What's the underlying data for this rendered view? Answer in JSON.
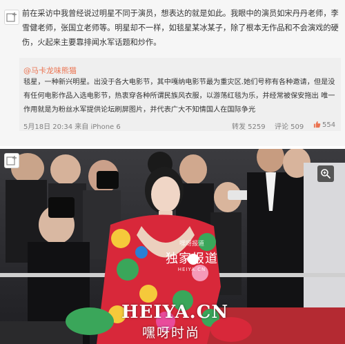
{
  "post": {
    "text": "前在采访中我曾经说过明星不同于演员，想表达的就是如此。我眼中的演员如宋丹丹老师，李雪健老师，张国立老师等。明星却不一样，如毯星某冰某子，除了根本无作品和不会演戏的硬伤，火起来主要靠排闻水军话题和炒作。",
    "quote": {
      "author": "@马卡龙味熊猫",
      "text": "毯星，一种新兴明星。出没于各大电影节，其中嘎纳电影节最为重灾区.她们号称有各种邀请，但是没有任何电影作品入选电影节，热衷穿各种所谓民族风衣服，以游荡红毯为乐，并经常被保安拖出 唯一作用就是为粉丝水军提供论坛刷屏图片，并代表广大不知情国人在国际争光"
    },
    "meta": {
      "time": "5月18日 20:34 来自 iPhone 6",
      "repost": "转发 5259",
      "comment": "评论 509",
      "like": "554"
    }
  },
  "photo": {
    "badge_small": "嘿呀报道",
    "badge_main": "独家报道",
    "badge_sub": "HEIYA.CN",
    "domain": "HEIYA.CN",
    "brand": "嘿呀时尚"
  },
  "colors": {
    "author": "#eb7350",
    "meta": "#808080",
    "dress_red": "#d8283a",
    "dress_green": "#3aa65a"
  },
  "icons": [
    "plus-icon",
    "like-icon",
    "zoom-icon"
  ]
}
